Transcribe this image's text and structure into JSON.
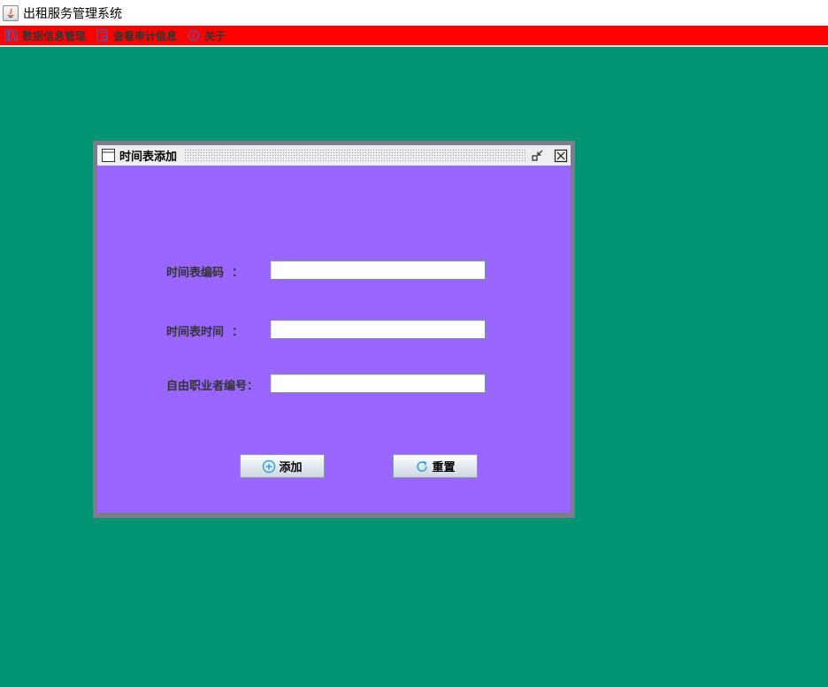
{
  "app": {
    "title": "出租服务管理系统"
  },
  "menubar": {
    "items": [
      {
        "label": "数据信息管理",
        "icon": "books-icon"
      },
      {
        "label": "查看审计信息",
        "icon": "audit-icon"
      },
      {
        "label": "关于",
        "icon": "info-icon"
      }
    ]
  },
  "internal_frame": {
    "title": "时间表添加",
    "fields": [
      {
        "label": "时间表编码  ：",
        "value": ""
      },
      {
        "label": "时间表时间  ：",
        "value": ""
      },
      {
        "label": "自由职业者编号：",
        "value": ""
      }
    ],
    "add_button": "添加",
    "reset_button": "重置"
  },
  "colors": {
    "desktop": "#009473",
    "menubar": "#ff0000",
    "frame_body": "#9966ff",
    "button_icon": "#2a9fd6"
  }
}
